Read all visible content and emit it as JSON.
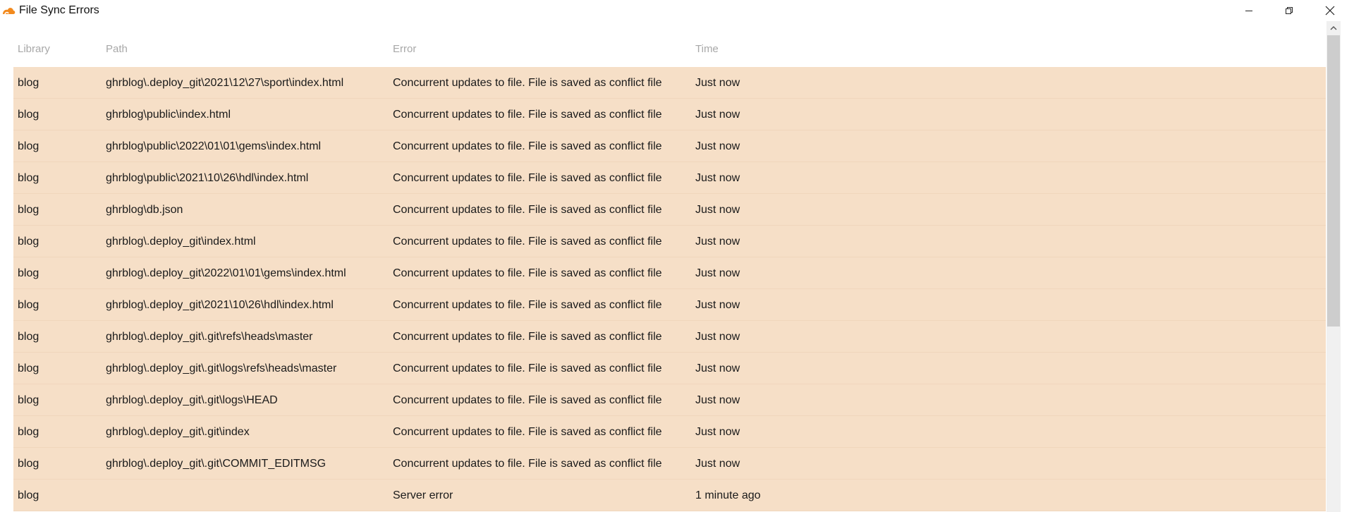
{
  "window": {
    "title": "File Sync Errors",
    "app_icon": "seafile-cloud-icon",
    "controls": {
      "minimize_icon": "minimize-icon",
      "maximize_icon": "restore-icon",
      "close_icon": "close-icon"
    }
  },
  "table": {
    "columns": [
      "Library",
      "Path",
      "Error",
      "Time"
    ],
    "rows": [
      {
        "library": "blog",
        "path": "ghrblog\\.deploy_git\\2021\\12\\27\\sport\\index.html",
        "error": "Concurrent updates to file. File is saved as conflict file",
        "time": "Just now"
      },
      {
        "library": "blog",
        "path": "ghrblog\\public\\index.html",
        "error": "Concurrent updates to file. File is saved as conflict file",
        "time": "Just now"
      },
      {
        "library": "blog",
        "path": "ghrblog\\public\\2022\\01\\01\\gems\\index.html",
        "error": "Concurrent updates to file. File is saved as conflict file",
        "time": "Just now"
      },
      {
        "library": "blog",
        "path": "ghrblog\\public\\2021\\10\\26\\hdl\\index.html",
        "error": "Concurrent updates to file. File is saved as conflict file",
        "time": "Just now"
      },
      {
        "library": "blog",
        "path": "ghrblog\\db.json",
        "error": "Concurrent updates to file. File is saved as conflict file",
        "time": "Just now"
      },
      {
        "library": "blog",
        "path": "ghrblog\\.deploy_git\\index.html",
        "error": "Concurrent updates to file. File is saved as conflict file",
        "time": "Just now"
      },
      {
        "library": "blog",
        "path": "ghrblog\\.deploy_git\\2022\\01\\01\\gems\\index.html",
        "error": "Concurrent updates to file. File is saved as conflict file",
        "time": "Just now"
      },
      {
        "library": "blog",
        "path": "ghrblog\\.deploy_git\\2021\\10\\26\\hdl\\index.html",
        "error": "Concurrent updates to file. File is saved as conflict file",
        "time": "Just now"
      },
      {
        "library": "blog",
        "path": "ghrblog\\.deploy_git\\.git\\refs\\heads\\master",
        "error": "Concurrent updates to file. File is saved as conflict file",
        "time": "Just now"
      },
      {
        "library": "blog",
        "path": "ghrblog\\.deploy_git\\.git\\logs\\refs\\heads\\master",
        "error": "Concurrent updates to file. File is saved as conflict file",
        "time": "Just now"
      },
      {
        "library": "blog",
        "path": "ghrblog\\.deploy_git\\.git\\logs\\HEAD",
        "error": "Concurrent updates to file. File is saved as conflict file",
        "time": "Just now"
      },
      {
        "library": "blog",
        "path": "ghrblog\\.deploy_git\\.git\\index",
        "error": "Concurrent updates to file. File is saved as conflict file",
        "time": "Just now"
      },
      {
        "library": "blog",
        "path": "ghrblog\\.deploy_git\\.git\\COMMIT_EDITMSG",
        "error": "Concurrent updates to file. File is saved as conflict file",
        "time": "Just now"
      },
      {
        "library": "blog",
        "path": "",
        "error": "Server error",
        "time": "1 minute ago"
      }
    ]
  },
  "scrollbar": {
    "up_icon": "scroll-up-arrow-icon"
  },
  "colors": {
    "row_background": "#f6dfc7",
    "header_text": "#a8a8a8",
    "scroll_thumb": "#cdcdcd",
    "icon_orange": "#f28a1e"
  }
}
